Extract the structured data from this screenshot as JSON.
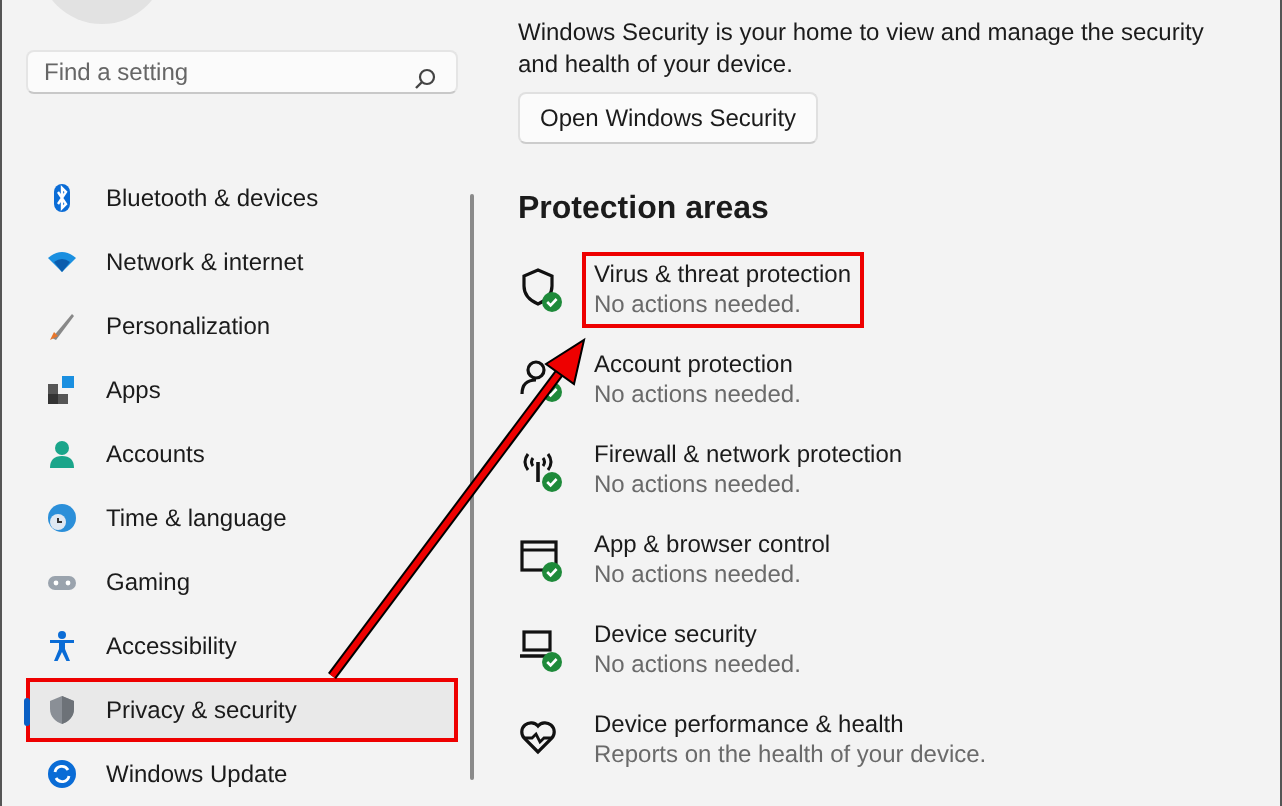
{
  "search": {
    "placeholder": "Find a setting"
  },
  "sidebar": {
    "items": [
      {
        "label": "Bluetooth & devices",
        "selected": false,
        "highlighted": false
      },
      {
        "label": "Network & internet",
        "selected": false,
        "highlighted": false
      },
      {
        "label": "Personalization",
        "selected": false,
        "highlighted": false
      },
      {
        "label": "Apps",
        "selected": false,
        "highlighted": false
      },
      {
        "label": "Accounts",
        "selected": false,
        "highlighted": false
      },
      {
        "label": "Time & language",
        "selected": false,
        "highlighted": false
      },
      {
        "label": "Gaming",
        "selected": false,
        "highlighted": false
      },
      {
        "label": "Accessibility",
        "selected": false,
        "highlighted": false
      },
      {
        "label": "Privacy & security",
        "selected": true,
        "highlighted": true
      },
      {
        "label": "Windows Update",
        "selected": false,
        "highlighted": false
      }
    ]
  },
  "content": {
    "description": "Windows Security is your home to view and manage the security and health of your device.",
    "button": "Open Windows Security",
    "heading": "Protection areas",
    "areas": [
      {
        "title": "Virus & threat protection",
        "status": "No actions needed.",
        "ok": true,
        "highlighted": true
      },
      {
        "title": "Account protection",
        "status": "No actions needed.",
        "ok": true,
        "highlighted": false
      },
      {
        "title": "Firewall & network protection",
        "status": "No actions needed.",
        "ok": true,
        "highlighted": false
      },
      {
        "title": "App & browser control",
        "status": "No actions needed.",
        "ok": true,
        "highlighted": false
      },
      {
        "title": "Device security",
        "status": "No actions needed.",
        "ok": true,
        "highlighted": false
      },
      {
        "title": "Device performance & health",
        "status": "Reports on the health of your device.",
        "ok": false,
        "highlighted": false
      }
    ]
  },
  "annotation": {
    "arrow": true
  }
}
